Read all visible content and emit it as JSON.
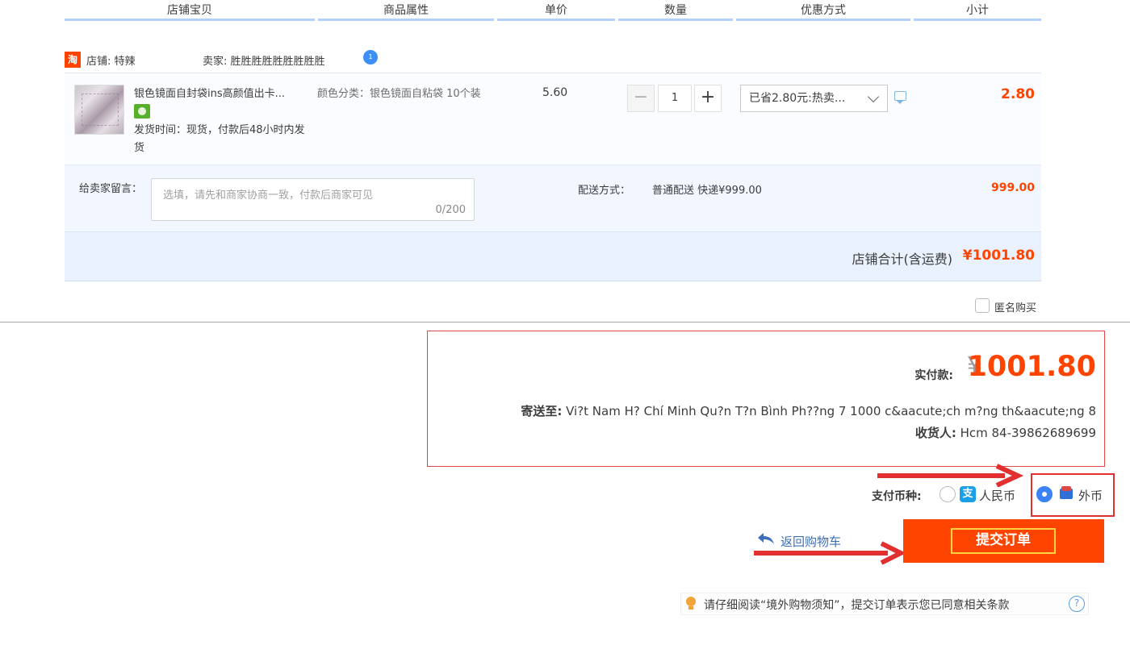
{
  "table_header": {
    "shop_item": "店铺宝贝",
    "attributes": "商品属性",
    "unit_price": "单价",
    "quantity": "数量",
    "promotion": "优惠方式",
    "subtotal": "小计"
  },
  "shop": {
    "logo_glyph": "淘",
    "name_label": "店铺: 特辣",
    "seller_label": "卖家: 胜胜胜胜胜胜胜胜胜",
    "wangwang_badge": "1"
  },
  "item": {
    "title": "银色镜面自封袋ins高颜值出卡...",
    "ship_time": "发货时间：现货，付款后48小时内发货",
    "attribute": "颜色分类：银色镜面自粘袋 10个装",
    "unit_price": "5.60",
    "quantity": "1",
    "quantity_minus": "−",
    "quantity_plus": "+",
    "promotion_selected": "已省2.80元:热卖...",
    "subtotal": "2.80"
  },
  "message": {
    "label": "给卖家留言：",
    "placeholder": "选填，请先和商家协商一致，付款后商家可见",
    "count": "0/200"
  },
  "shipping": {
    "label": "配送方式：",
    "method": "普通配送 快递¥999.00",
    "fee": "999.00"
  },
  "shop_total": {
    "label": "店铺合计(含运费)",
    "value": "¥1001.80"
  },
  "anonymous": {
    "label": "匿名购买",
    "checked": false
  },
  "summary": {
    "pay_label": "实付款:",
    "currency_symbol": "¥",
    "pay_amount": "1001.80",
    "ship_to_label": "寄送至:",
    "ship_to_address": "Vi?t Nam H? Chí Minh Qu?n T?n Bình Ph??ng 7 1000 c&aacute;ch m?ng th&aacute;ng 8",
    "receiver_label": "收货人:",
    "receiver_value": "Hcm 84-39862689699"
  },
  "currency": {
    "label": "支付币种:",
    "option_rmb": "人民币",
    "option_foreign": "外币",
    "alipay_glyph": "支",
    "selected": "外币"
  },
  "actions": {
    "back_label": "返回购物车",
    "submit_label": "提交订单"
  },
  "notice": {
    "text": "请仔细阅读“境外购物须知”，提交订单表示您已同意相关条款",
    "help_glyph": "?"
  },
  "colors": {
    "accent": "#ff4400",
    "annotation_red": "#e23030",
    "highlight_yellow": "#ffd43b",
    "link_blue": "#3c6fb8"
  }
}
